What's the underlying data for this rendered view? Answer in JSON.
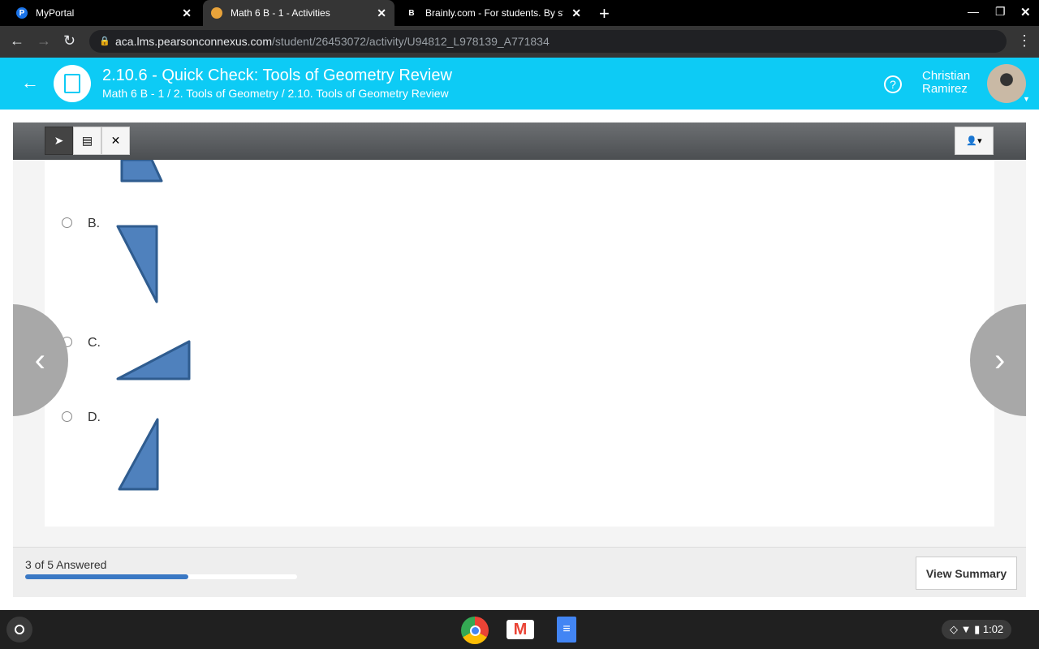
{
  "browser": {
    "tabs": [
      {
        "title": "MyPortal",
        "active": false
      },
      {
        "title": "Math 6 B - 1 - Activities",
        "active": true
      },
      {
        "title": "Brainly.com - For students. By st",
        "active": false
      }
    ],
    "url_host": "aca.lms.pearsonconnexus.com",
    "url_path": "/student/26453072/activity/U94812_L978139_A771834"
  },
  "header": {
    "title": "2.10.6 - Quick Check: Tools of Geometry Review",
    "breadcrumb": "Math 6 B - 1 / 2. Tools of Geometry / 2.10. Tools of Geometry Review",
    "user_first": "Christian",
    "user_last": "Ramirez",
    "color": "#0dcbf5"
  },
  "options": [
    {
      "letter": "B."
    },
    {
      "letter": "C."
    },
    {
      "letter": "D."
    }
  ],
  "footer": {
    "status": "3 of 5 Answered",
    "progress_percent": 60,
    "view_summary": "View Summary"
  },
  "shelf": {
    "time": "1:02"
  },
  "triangle_color": "#4f81bd"
}
